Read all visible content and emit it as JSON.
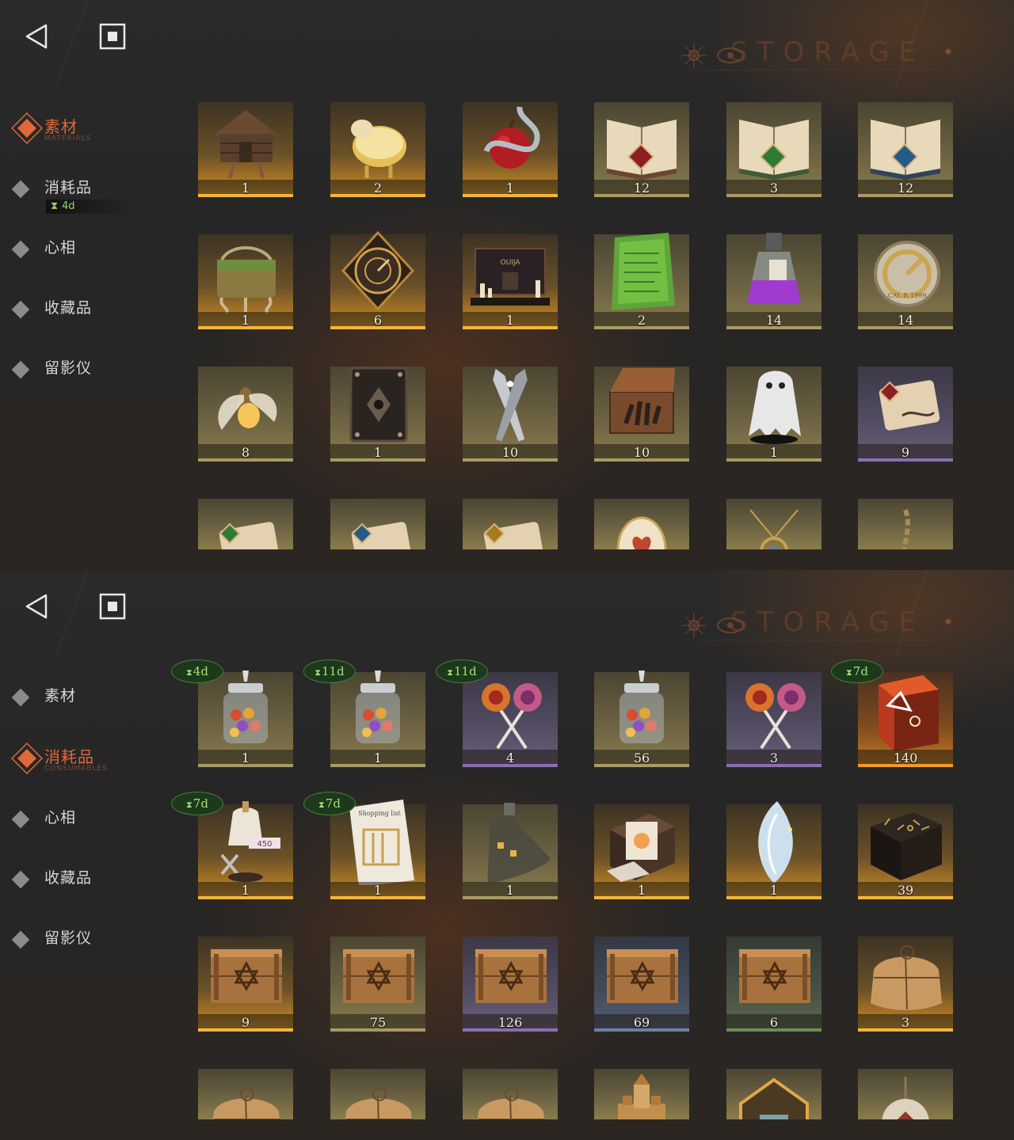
{
  "header": {
    "title": "STORAGE"
  },
  "panels": [
    {
      "nav": [
        {
          "label": "素材",
          "sub": "MATERIALS",
          "active": true
        },
        {
          "label": "消耗品",
          "sub": "",
          "active": false,
          "timer": "4d"
        },
        {
          "label": "心相",
          "sub": "",
          "active": false
        },
        {
          "label": "收藏品",
          "sub": "",
          "active": false
        },
        {
          "label": "留影仪",
          "sub": "",
          "active": false
        }
      ],
      "items": [
        {
          "icon": "hut-on-legs-icon",
          "count": "1",
          "rarity": "gold"
        },
        {
          "icon": "golden-sheep-icon",
          "count": "2",
          "rarity": "gold"
        },
        {
          "icon": "apple-serpent-icon",
          "count": "1",
          "rarity": "gold"
        },
        {
          "icon": "red-rune-book-icon",
          "count": "12",
          "rarity": "khaki"
        },
        {
          "icon": "green-rune-book-icon",
          "count": "3",
          "rarity": "khaki"
        },
        {
          "icon": "blue-rune-book-icon",
          "count": "12",
          "rarity": "khaki"
        },
        {
          "icon": "rooted-chest-icon",
          "count": "1",
          "rarity": "gold"
        },
        {
          "icon": "astrolabe-icon",
          "count": "6",
          "rarity": "gold"
        },
        {
          "icon": "ouija-board-icon",
          "count": "1",
          "rarity": "gold"
        },
        {
          "icon": "green-tablet-icon",
          "count": "2",
          "rarity": "khaki"
        },
        {
          "icon": "potion-bottle-icon",
          "count": "14",
          "rarity": "khaki"
        },
        {
          "icon": "pocket-watch-icon",
          "count": "14",
          "rarity": "khaki"
        },
        {
          "icon": "firefly-icon",
          "count": "8",
          "rarity": "khaki"
        },
        {
          "icon": "dark-tome-icon",
          "count": "1",
          "rarity": "khaki"
        },
        {
          "icon": "silver-bullets-icon",
          "count": "10",
          "rarity": "khaki"
        },
        {
          "icon": "hand-in-box-icon",
          "count": "10",
          "rarity": "khaki"
        },
        {
          "icon": "ghost-icon",
          "count": "1",
          "rarity": "khaki"
        },
        {
          "icon": "red-scroll-icon",
          "count": "9",
          "rarity": "purple"
        }
      ],
      "partial_items": [
        {
          "icon": "green-scroll-icon"
        },
        {
          "icon": "blue-scroll-icon"
        },
        {
          "icon": "gold-scroll-icon"
        },
        {
          "icon": "heart-egg-icon"
        },
        {
          "icon": "pendant-icon"
        },
        {
          "icon": "chain-icon"
        }
      ]
    },
    {
      "nav": [
        {
          "label": "素材",
          "sub": "",
          "active": false
        },
        {
          "label": "消耗品",
          "sub": "CONSUMABLES",
          "active": true
        },
        {
          "label": "心相",
          "sub": "",
          "active": false
        },
        {
          "label": "收藏品",
          "sub": "",
          "active": false
        },
        {
          "label": "留影仪",
          "sub": "",
          "active": false
        }
      ],
      "items": [
        {
          "icon": "candy-jar-icon",
          "count": "1",
          "rarity": "khaki",
          "timer": "4d"
        },
        {
          "icon": "candy-jar-icon",
          "count": "1",
          "rarity": "khaki",
          "timer": "11d"
        },
        {
          "icon": "lollipops-icon",
          "count": "4",
          "rarity": "purple",
          "timer": "11d"
        },
        {
          "icon": "candy-jar-icon",
          "count": "56",
          "rarity": "khaki"
        },
        {
          "icon": "lollipops-icon",
          "count": "3",
          "rarity": "purple"
        },
        {
          "icon": "rune-cube-icon",
          "count": "140",
          "rarity": "orange",
          "timer": "7d"
        },
        {
          "icon": "tailor-mannequin-icon",
          "count": "1",
          "rarity": "gold",
          "timer": "7d"
        },
        {
          "icon": "shopping-list-icon",
          "count": "1",
          "rarity": "gold",
          "timer": "7d"
        },
        {
          "icon": "bottle-icon",
          "count": "1",
          "rarity": "khaki"
        },
        {
          "icon": "gift-box-icon",
          "count": "1",
          "rarity": "gold"
        },
        {
          "icon": "crystal-shard-icon",
          "count": "1",
          "rarity": "gold"
        },
        {
          "icon": "rune-chest-icon",
          "count": "39",
          "rarity": "gold"
        },
        {
          "icon": "wooden-crate-icon",
          "count": "9",
          "rarity": "gold"
        },
        {
          "icon": "wooden-crate-icon",
          "count": "75",
          "rarity": "khaki"
        },
        {
          "icon": "wooden-crate-icon",
          "count": "126",
          "rarity": "purple"
        },
        {
          "icon": "wooden-crate-icon",
          "count": "69",
          "rarity": "slate"
        },
        {
          "icon": "wooden-crate-icon",
          "count": "6",
          "rarity": "green"
        },
        {
          "icon": "parcel-icon",
          "count": "3",
          "rarity": "gold"
        }
      ],
      "partial_items": [
        {
          "icon": "parcel-icon"
        },
        {
          "icon": "parcel-icon"
        },
        {
          "icon": "parcel-icon"
        },
        {
          "icon": "castle-icon"
        },
        {
          "icon": "frame-icon"
        },
        {
          "icon": "ornament-icon"
        }
      ]
    }
  ],
  "colors": {
    "accent": "#e0683a",
    "timer_green": "#a5df78",
    "gold": "#f3b53b",
    "khaki": "#a89b63",
    "purple": "#8a6fb0",
    "slate": "#6f80a8",
    "green": "#6b8d57",
    "orange": "#f39a2a"
  }
}
